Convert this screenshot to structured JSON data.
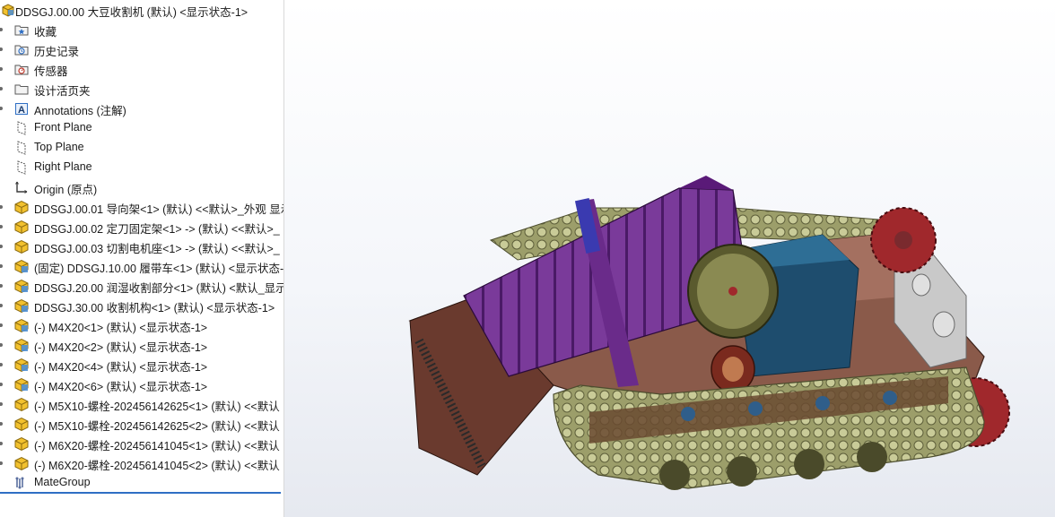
{
  "tree": {
    "root": "DDSGJ.00.00 大豆收割机 (默认) <显示状态-1>",
    "items": [
      {
        "label": "收藏",
        "icon": "favorites-folder-icon"
      },
      {
        "label": "历史记录",
        "icon": "history-folder-icon"
      },
      {
        "label": "传感器",
        "icon": "sensors-folder-icon"
      },
      {
        "label": "设计活页夹",
        "icon": "design-binder-icon"
      },
      {
        "label": "Annotations (注解)",
        "icon": "annotations-icon"
      },
      {
        "label": "Front Plane",
        "icon": "plane-icon"
      },
      {
        "label": "Top Plane",
        "icon": "plane-icon"
      },
      {
        "label": "Right Plane",
        "icon": "plane-icon"
      },
      {
        "label": "Origin (原点)",
        "icon": "origin-icon"
      },
      {
        "label": "DDSGJ.00.01 导向架<1> (默认) <<默认>_外观 显示",
        "icon": "part-icon"
      },
      {
        "label": "DDSGJ.00.02 定刀固定架<1> -> (默认) <<默认>_",
        "icon": "part-icon"
      },
      {
        "label": "DDSGJ.00.03 切割电机座<1> -> (默认) <<默认>_",
        "icon": "part-icon"
      },
      {
        "label": "(固定) DDSGJ.10.00 履带车<1> (默认) <显示状态-",
        "icon": "subassembly-icon"
      },
      {
        "label": "DDSGJ.20.00 润湿收割部分<1> (默认) <默认_显示",
        "icon": "subassembly-icon"
      },
      {
        "label": "DDSGJ.30.00 收割机构<1> (默认) <显示状态-1>",
        "icon": "subassembly-icon"
      },
      {
        "label": "(-) M4X20<1> (默认) <显示状态-1>",
        "icon": "subassembly-icon"
      },
      {
        "label": "(-) M4X20<2> (默认) <显示状态-1>",
        "icon": "subassembly-icon"
      },
      {
        "label": "(-) M4X20<4> (默认) <显示状态-1>",
        "icon": "subassembly-icon"
      },
      {
        "label": "(-) M4X20<6> (默认) <显示状态-1>",
        "icon": "subassembly-icon"
      },
      {
        "label": "(-) M5X10-螺栓-202456142625<1> (默认) <<默认",
        "icon": "part-icon"
      },
      {
        "label": "(-) M5X10-螺栓-202456142625<2> (默认) <<默认",
        "icon": "part-icon"
      },
      {
        "label": "(-) M6X20-螺栓-202456141045<1> (默认) <<默认",
        "icon": "part-icon"
      },
      {
        "label": "(-) M6X20-螺栓-202456141045<2> (默认) <<默认",
        "icon": "part-icon"
      },
      {
        "label": "MateGroup",
        "icon": "mategroup-icon"
      }
    ]
  },
  "colors": {
    "track": "#b7b98a",
    "frame": "#7a4a3a",
    "hopper": "#6a2b8a",
    "box": "#2b4f6e",
    "sprocket": "#a0282c",
    "pulley": "#6e6c3a",
    "accent": "#2f6fc4"
  }
}
